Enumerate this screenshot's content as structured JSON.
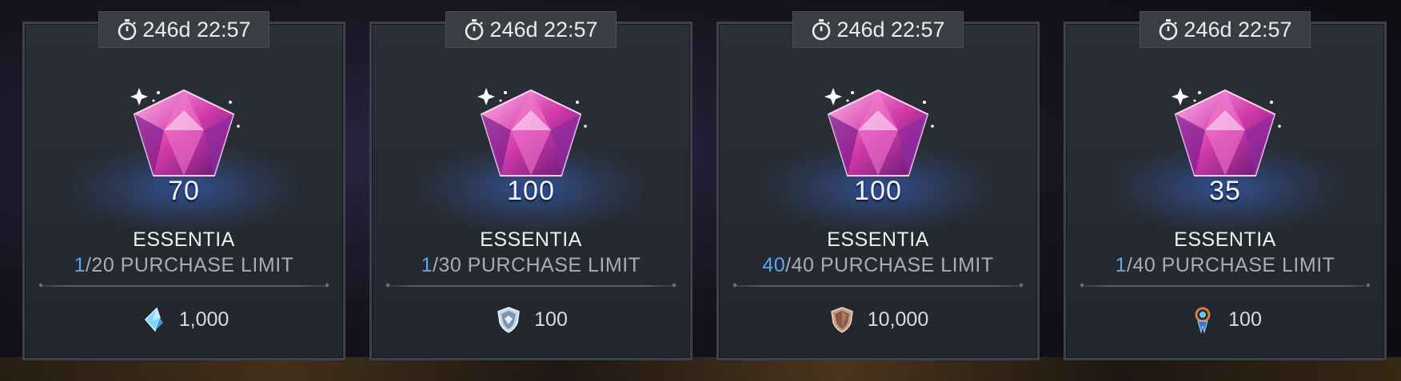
{
  "cards": [
    {
      "timer": "246d 22:57",
      "amount": "70",
      "title": "ESSENTIA",
      "limit_current": "1",
      "limit_rest": "/20 PURCHASE LIMIT",
      "price": "1,000",
      "currency_icon": "crystal-shard-icon"
    },
    {
      "timer": "246d 22:57",
      "amount": "100",
      "title": "ESSENTIA",
      "limit_current": "1",
      "limit_rest": "/30 PURCHASE LIMIT",
      "price": "100",
      "currency_icon": "silver-shield-icon"
    },
    {
      "timer": "246d 22:57",
      "amount": "100",
      "title": "ESSENTIA",
      "limit_current": "40",
      "limit_rest": "/40 PURCHASE LIMIT",
      "price": "10,000",
      "currency_icon": "bronze-shield-icon"
    },
    {
      "timer": "246d 22:57",
      "amount": "35",
      "title": "ESSENTIA",
      "limit_current": "1",
      "limit_rest": "/40 PURCHASE LIMIT",
      "price": "100",
      "currency_icon": "blue-orb-token-icon"
    }
  ],
  "colors": {
    "limit_current": "#5aa7f0",
    "card_bg": "#2b2f36",
    "timer_bg": "#3a3e44"
  }
}
